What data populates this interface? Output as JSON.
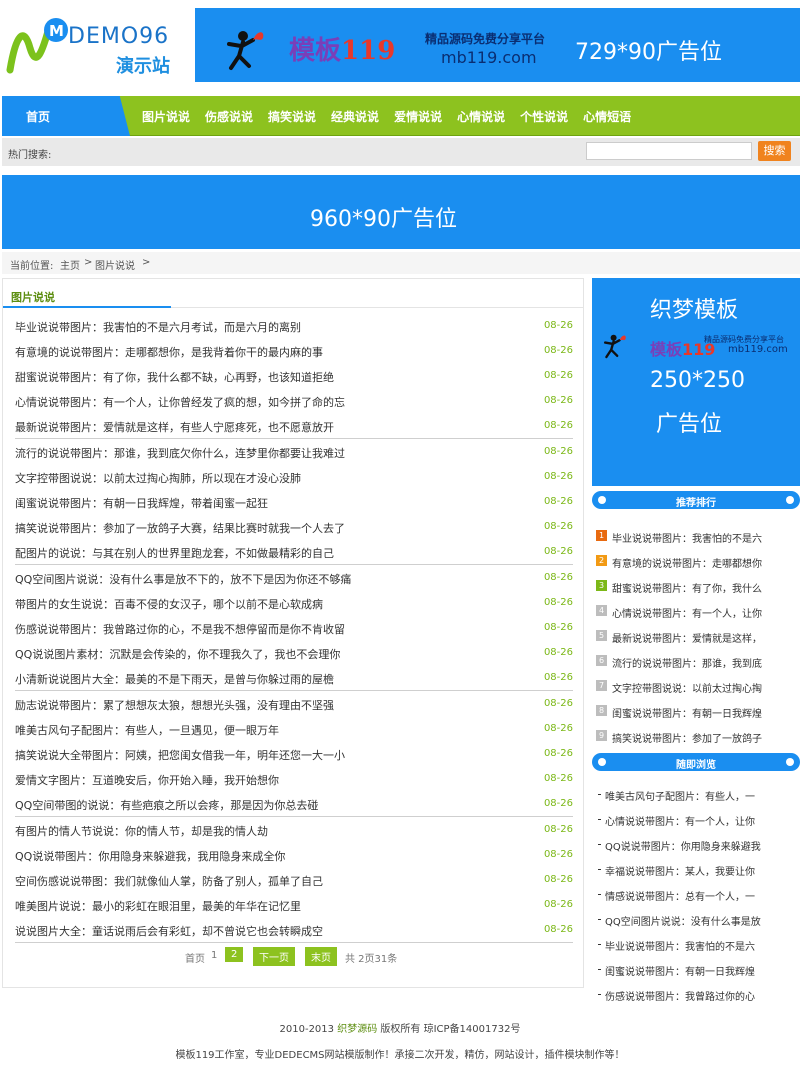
{
  "header": {
    "logo_text": "DEMO96",
    "logo_cn": "演示站",
    "top_banner": {
      "brand": "模板",
      "brand_num": "119",
      "tagline": "精品源码免费分享平台",
      "domain": "mb119.com",
      "label": "729*90广告位"
    }
  },
  "nav": {
    "home": "首页",
    "items": [
      "图片说说",
      "伤感说说",
      "搞笑说说",
      "经典说说",
      "爱情说说",
      "心情说说",
      "个性说说",
      "心情短语"
    ]
  },
  "search": {
    "hot_label": "热门搜索:",
    "placeholder": "",
    "button": "搜索"
  },
  "mid_banner": {
    "label": "960*90广告位"
  },
  "breadcrumb": {
    "prefix": "当前位置:",
    "home": "主页",
    "current": "图片说说",
    "sep": ">"
  },
  "main": {
    "title": "图片说说",
    "rows": [
      {
        "t": "毕业说说带图片：我害怕的不是六月考试，而是六月的离别",
        "d": "08-26"
      },
      {
        "t": "有意境的说说带图片：走哪都想你，是我背着你干的最内麻的事",
        "d": "08-26"
      },
      {
        "t": "甜蜜说说带图片：有了你，我什么都不缺，心再野，也该知道拒绝",
        "d": "08-26"
      },
      {
        "t": "心情说说带图片：有一个人，让你曾经发了疯的想，如今拼了命的忘",
        "d": "08-26"
      },
      {
        "t": "最新说说带图片：爱情就是这样，有些人宁愿疼死，也不愿意放开",
        "d": "08-26"
      },
      {
        "t": "流行的说说带图片：那谁，我到底欠你什么，连梦里你都要让我难过",
        "d": "08-26"
      },
      {
        "t": "文字控带图说说：以前太过掏心掏肺，所以现在才没心没肺",
        "d": "08-26"
      },
      {
        "t": "闺蜜说说带图片：有朝一日我辉煌，带着闺蜜一起狂",
        "d": "08-26"
      },
      {
        "t": "搞笑说说带图片：参加了一放鸽子大赛，结果比赛时就我一个人去了",
        "d": "08-26"
      },
      {
        "t": "配图片的说说：与其在别人的世界里跑龙套，不如做最精彩的自己",
        "d": "08-26"
      },
      {
        "t": "QQ空间图片说说：没有什么事是放不下的，放不下是因为你还不够痛",
        "d": "08-26"
      },
      {
        "t": "带图片的女生说说：百毒不侵的女汉子，哪个以前不是心软成病",
        "d": "08-26"
      },
      {
        "t": "伤感说说带图片：我曾路过你的心，不是我不想停留而是你不肯收留",
        "d": "08-26"
      },
      {
        "t": "QQ说说图片素材：沉默是会传染的，你不理我久了，我也不会理你",
        "d": "08-26"
      },
      {
        "t": "小清新说说图片大全：最美的不是下雨天，是曾与你躲过雨的屋檐",
        "d": "08-26"
      },
      {
        "t": "励志说说带图片：累了想想灰太狼，想想光头强，没有理由不坚强",
        "d": "08-26"
      },
      {
        "t": "唯美古风句子配图片：有些人，一旦遇见，便一眼万年",
        "d": "08-26"
      },
      {
        "t": "搞笑说说大全带图片：阿姨，把您闺女借我一年，明年还您一大一小",
        "d": "08-26"
      },
      {
        "t": "爱情文字图片：互道晚安后，你开始入睡，我开始想你",
        "d": "08-26"
      },
      {
        "t": "QQ空间带图的说说：有些疤痕之所以会疼，那是因为你总去碰",
        "d": "08-26"
      },
      {
        "t": "有图片的情人节说说：你的情人节，却是我的情人劫",
        "d": "08-26"
      },
      {
        "t": "QQ说说带图片：你用隐身来躲避我，我用隐身来成全你",
        "d": "08-26"
      },
      {
        "t": "空间伤感说说带图：我们就像仙人掌，防备了别人，孤单了自己",
        "d": "08-26"
      },
      {
        "t": "唯美图片说说：最小的彩虹在眼泪里，最美的年华在记忆里",
        "d": "08-26"
      },
      {
        "t": "说说图片大全：童话说雨后会有彩虹，却不曾说它也会转瞬成空",
        "d": "08-26"
      }
    ],
    "pager": {
      "first": "首页",
      "p1": "1",
      "p2": "2",
      "next": "下一页",
      "last": "末页",
      "total": "共 2页31条"
    }
  },
  "side_ad": {
    "title": "织梦模板",
    "brand": "模板",
    "brand_num": "119",
    "tag": "精品源码免费分享平台",
    "domain": "mb119.com",
    "size": "250*250",
    "label": "广告位"
  },
  "rank": {
    "title": "推荐排行",
    "items": [
      "毕业说说带图片：我害怕的不是六",
      "有意境的说说带图片：走哪都想你",
      "甜蜜说说带图片：有了你，我什么",
      "心情说说带图片：有一个人，让你",
      "最新说说带图片：爱情就是这样，",
      "流行的说说带图片：那谁，我到底",
      "文字控带图说说：以前太过掏心掏",
      "闺蜜说说带图片：有朝一日我辉煌",
      "搞笑说说带图片：参加了一放鸽子"
    ],
    "colors": [
      "#e86a10",
      "#f29a14",
      "#7cb818",
      "#bdbdbd",
      "#bdbdbd",
      "#bdbdbd",
      "#bdbdbd",
      "#bdbdbd",
      "#bdbdbd"
    ]
  },
  "random": {
    "title": "随即浏览",
    "items": [
      "唯美古风句子配图片：有些人，一",
      "心情说说带图片：有一个人，让你",
      "QQ说说带图片：你用隐身来躲避我",
      "幸福说说带图片：某人，我要让你",
      "情感说说带图片：总有一个人，一",
      "QQ空间图片说说：没有什么事是放",
      "毕业说说带图片：我害怕的不是六",
      "闺蜜说说带图片：有朝一日我辉煌",
      "伤感说说带图片：我曾路过你的心"
    ]
  },
  "footer": {
    "year": "2010-2013",
    "site": "织梦源码",
    "rights": "版权所有",
    "icp": "琼ICP备14001732号",
    "line2": "模板119工作室，专业DEDECMS网站模版制作！承接二次开发，精仿，网站设计，插件模块制作等！"
  }
}
